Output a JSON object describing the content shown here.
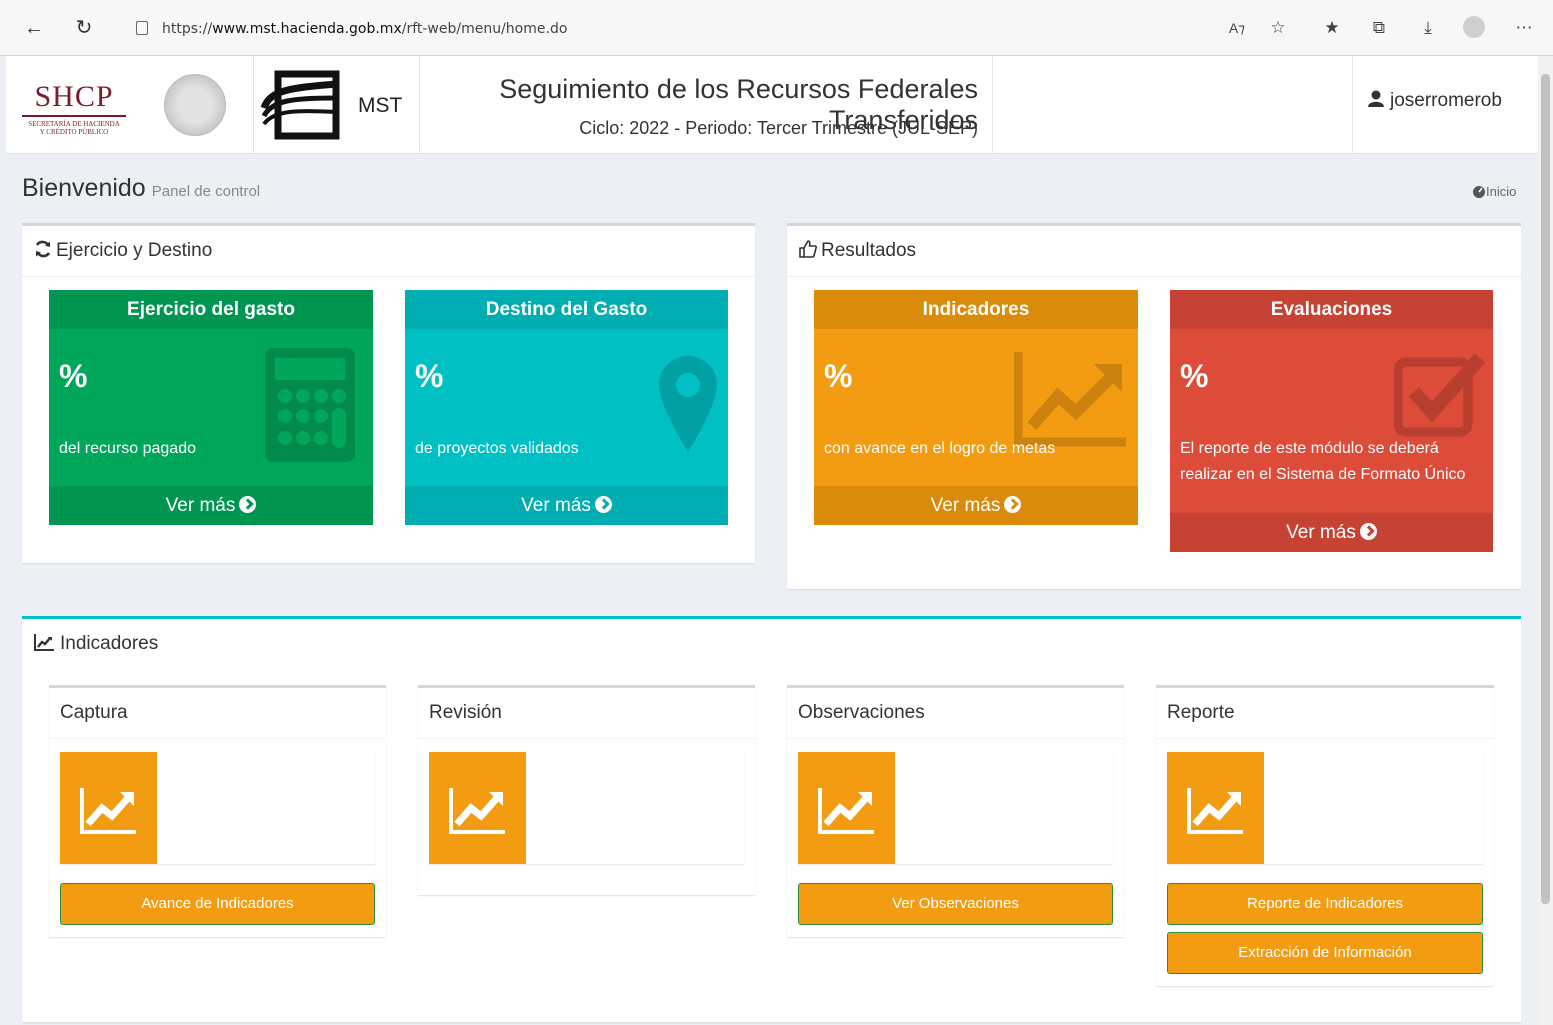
{
  "browser": {
    "url_prefix": "https://",
    "url_host": "www.mst.hacienda.gob.mx",
    "url_path": "/rft-web/menu/home.do"
  },
  "header": {
    "logo_big": "SHCP",
    "logo_small_1": "SECRETARÍA DE HACIENDA",
    "logo_small_2": "Y CRÉDITO PÚBLICO",
    "mst_label": "MST",
    "title": "Seguimiento de los Recursos Federales Transferidos",
    "subtitle": "Ciclo: 2022 - Periodo: Tercer Trimestre (JUL-SEP)",
    "user": "joserromerob"
  },
  "page": {
    "title": "Bienvenido",
    "subtitle": "Panel de control",
    "breadcrumb": "Inicio"
  },
  "ejercicio": {
    "title": "Ejercicio y Destino",
    "cards": [
      {
        "head": "Ejercicio del gasto",
        "pct": "%",
        "desc": "del recurso pagado",
        "foot": "Ver más",
        "icon": "calculator-icon",
        "color": "#00a65a"
      },
      {
        "head": "Destino del Gasto",
        "pct": "%",
        "desc": "de proyectos validados",
        "foot": "Ver más",
        "icon": "map-marker-icon",
        "color": "#00c0c4"
      }
    ]
  },
  "resultados": {
    "title": "Resultados",
    "cards": [
      {
        "head": "Indicadores",
        "pct": "%",
        "desc": "con avance en el logro de metas",
        "foot": "Ver más",
        "icon": "line-chart-icon",
        "color": "#f39c12"
      },
      {
        "head": "Evaluaciones",
        "pct": "%",
        "desc": "El reporte de este módulo se deberá realizar en el Sistema de Formato Único",
        "foot": "Ver más",
        "icon": "check-square-icon",
        "color": "#dd4b39"
      }
    ]
  },
  "indicadores": {
    "title": "Indicadores",
    "panels": [
      {
        "title": "Captura",
        "buttons": [
          "Avance de Indicadores"
        ]
      },
      {
        "title": "Revisión",
        "buttons": []
      },
      {
        "title": "Observaciones",
        "buttons": [
          "Ver Observaciones"
        ]
      },
      {
        "title": "Reporte",
        "buttons": [
          "Reporte de Indicadores",
          "Extracción de Información"
        ]
      }
    ]
  }
}
